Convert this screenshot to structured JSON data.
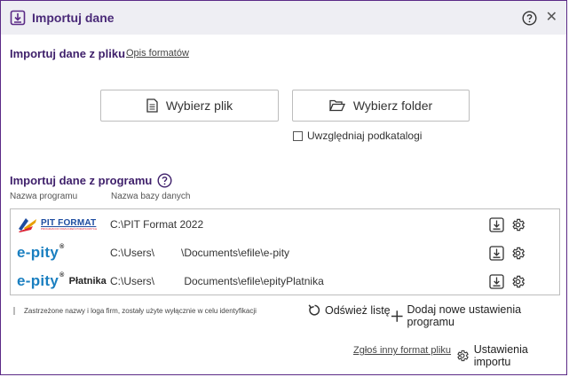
{
  "dialog": {
    "title": "Importuj dane",
    "help_icon": "help-circle-icon",
    "close_icon": "close-icon"
  },
  "file_section": {
    "heading": "Importuj dane z pliku",
    "formats_link": "Opis formatów",
    "choose_file_button": "Wybierz plik",
    "choose_folder_button": "Wybierz folder",
    "include_subfolders_label": "Uwzględniaj podkatalogi",
    "include_subfolders_checked": false
  },
  "program_section": {
    "heading": "Importuj dane z programu",
    "col_program": "Nazwa programu",
    "col_database": "Nazwa bazy danych",
    "rows": [
      {
        "logo": "PIT FORMAT",
        "logo_sub": "PROGRAM DO ROZLICZEŃ PODATKOWYCH",
        "path": "C:\\PIT Format 2022"
      },
      {
        "logo": "e-pity",
        "logo_sup": "®",
        "path": "C:\\Users\\         \\Documents\\efile\\e-pity"
      },
      {
        "logo": "e-pity",
        "logo_sup": "®",
        "logo_extra": "Płatnika",
        "path": "C:\\Users\\          Documents\\efile\\epityPlatnika"
      }
    ]
  },
  "footer": {
    "footnote": "Zastrzeżone nazwy i loga firm, zostały użyte wyłącznie w celu identyfikacji",
    "refresh_button": "Odśwież listę",
    "add_settings_button": "Dodaj nowe ustawienia programu",
    "report_link": "Zgłoś inny format pliku",
    "import_settings_button": "Ustawienia importu"
  },
  "colors": {
    "accent": "#5b2a86",
    "titlebar_bg": "#eeeef3",
    "heading": "#3e1f6a"
  }
}
